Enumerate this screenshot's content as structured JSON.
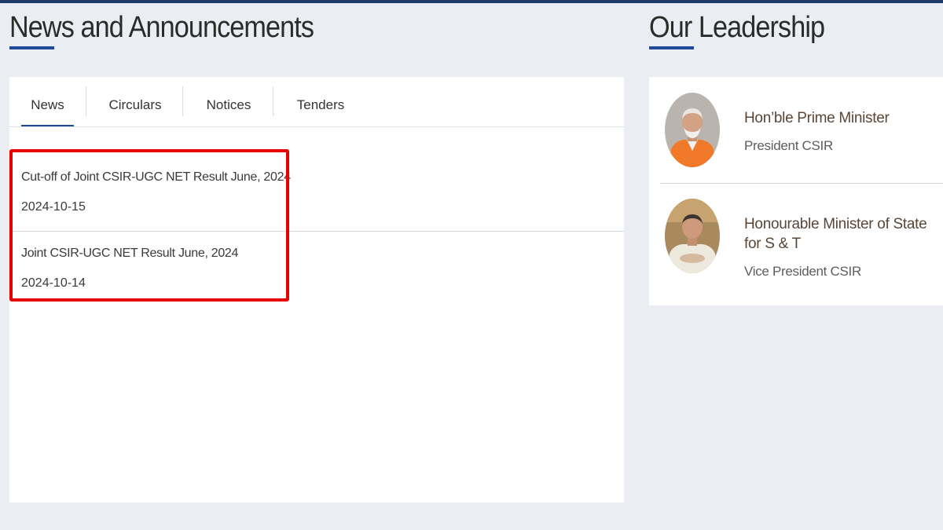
{
  "news_section": {
    "title": "News and Announcements",
    "tabs": [
      {
        "label": "News",
        "active": true
      },
      {
        "label": "Circulars",
        "active": false
      },
      {
        "label": "Notices",
        "active": false
      },
      {
        "label": "Tenders",
        "active": false
      }
    ],
    "items": [
      {
        "title": "Cut-off of Joint CSIR-UGC NET Result June, 2024",
        "date": "2024-10-15"
      },
      {
        "title": "Joint CSIR-UGC NET Result June, 2024",
        "date": "2024-10-14"
      }
    ]
  },
  "leadership_section": {
    "title": "Our Leadership",
    "leaders": [
      {
        "name": "Hon’ble Prime Minister",
        "role": "President CSIR"
      },
      {
        "name": "Honourable Minister of State for S & T",
        "role": "Vice President CSIR"
      }
    ]
  },
  "colors": {
    "accent": "#1f4a9a",
    "highlight": "#e60000",
    "page_background": "#eaedf1"
  }
}
